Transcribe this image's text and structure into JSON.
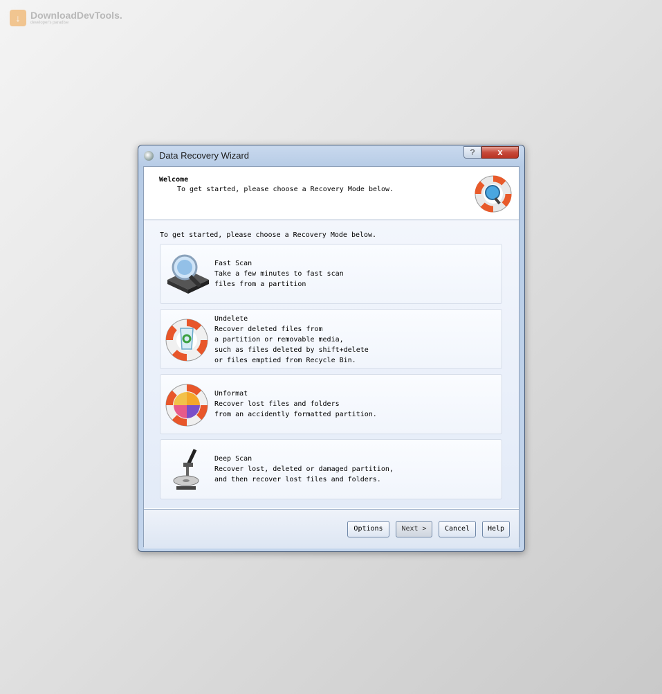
{
  "watermark": {
    "title": "DownloadDevTools.",
    "subtitle": "developer's paradise"
  },
  "window": {
    "title": "Data Recovery Wizard",
    "help_caption": "?",
    "close_caption": "x"
  },
  "header": {
    "title": "Welcome",
    "subtitle": "To get started, please choose a Recovery Mode below."
  },
  "intro": "To get started, please choose a Recovery Mode below.",
  "modes": [
    {
      "title": "Fast Scan",
      "description": "Take a few minutes to fast scan\nfiles from a partition",
      "icon": "hard-drive-magnifier-icon"
    },
    {
      "title": "Undelete",
      "description": "Recover deleted files from\na partition or removable media,\nsuch as files deleted by shift+delete\nor files emptied from Recycle Bin.",
      "icon": "recycle-bin-lifebuoy-icon"
    },
    {
      "title": "Unformat",
      "description": "Recover lost files and folders\nfrom an accidently formatted partition.",
      "icon": "pie-chart-lifebuoy-icon"
    },
    {
      "title": "Deep Scan",
      "description": "Recover lost, deleted or damaged partition,\nand then recover lost files and folders.",
      "icon": "microscope-disk-icon"
    }
  ],
  "buttons": {
    "options": "Options",
    "next": "Next >",
    "cancel": "Cancel",
    "help": "Help"
  }
}
